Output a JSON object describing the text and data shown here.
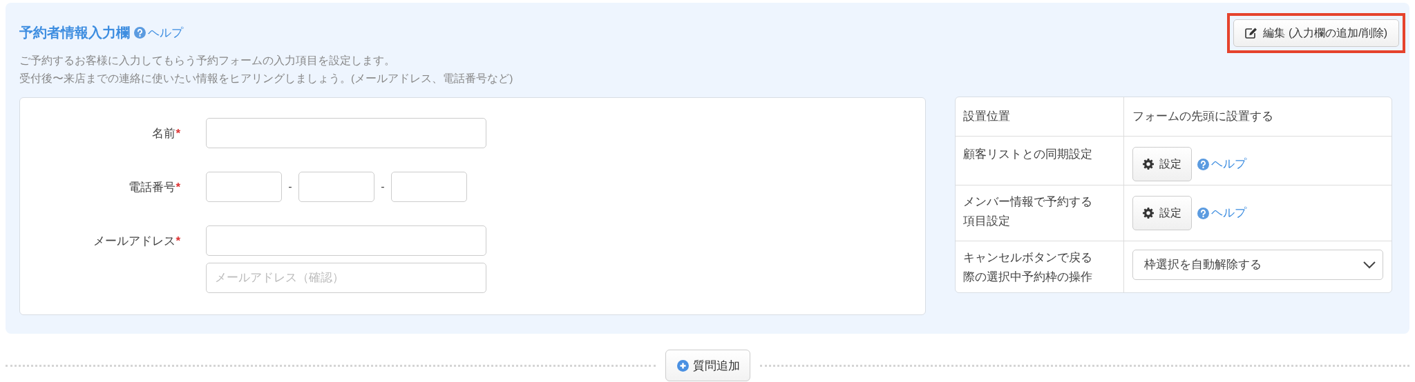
{
  "section": {
    "title": "予約者情報入力欄",
    "help_link": "ヘルプ",
    "description": [
      "ご予約するお客様に入力してもらう予約フォームの入力項目を設定します。",
      "受付後〜来店までの連絡に使いたい情報をヒアリングしましょう。(メールアドレス、電話番号など)"
    ],
    "edit_button": {
      "label": "編集 (入力欄の追加/削除)",
      "highlighted": true
    }
  },
  "form": {
    "required_mark": "*",
    "fields": [
      {
        "kind": "text",
        "label": "名前",
        "required": true
      },
      {
        "kind": "phone",
        "label": "電話番号",
        "required": true,
        "separators": [
          "-",
          "-"
        ]
      },
      {
        "kind": "email",
        "label": "メールアドレス",
        "required": true,
        "confirm_placeholder": "メールアドレス（確認）"
      }
    ]
  },
  "settings_table": {
    "rows": [
      {
        "kind": "text",
        "label": "設置位置",
        "value": "フォームの先頭に設置する"
      },
      {
        "kind": "button",
        "label": "顧客リストとの同期設定",
        "button": "設定",
        "help_link": "ヘルプ"
      },
      {
        "kind": "button",
        "label": "メンバー情報で予約する項目設定",
        "button": "設定",
        "help_link": "ヘルプ"
      },
      {
        "kind": "select",
        "label": "キャンセルボタンで戻る際の選択中予約枠の操作",
        "value": "枠選択を自動解除する"
      }
    ]
  },
  "add_question_button": "質問追加"
}
